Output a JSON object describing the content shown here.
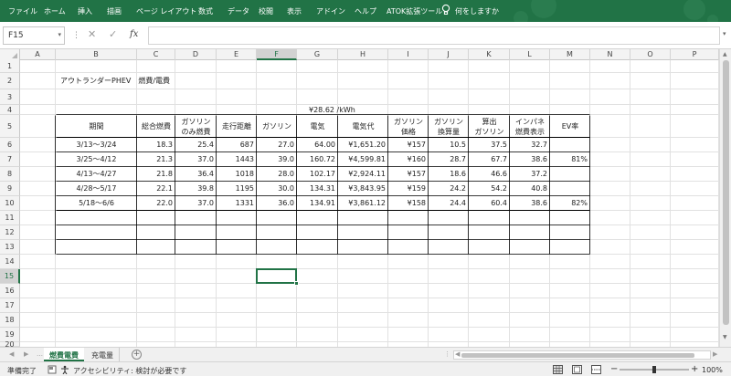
{
  "ribbon": {
    "tabs": [
      "ファイル",
      "ホーム",
      "挿入",
      "描画",
      "ページ レイアウト",
      "数式",
      "データ",
      "校閲",
      "表示",
      "アドイン",
      "ヘルプ",
      "ATOK拡張ツール"
    ],
    "tell_me": "何をしますか"
  },
  "formula_bar": {
    "name_box": "F15",
    "value": ""
  },
  "columns": [
    "A",
    "B",
    "C",
    "D",
    "E",
    "F",
    "G",
    "H",
    "I",
    "J",
    "K",
    "L",
    "M",
    "N",
    "O",
    "P"
  ],
  "rows": [
    "1",
    "2",
    "3",
    "4",
    "5",
    "6",
    "7",
    "8",
    "9",
    "10",
    "11",
    "12",
    "13",
    "14",
    "15",
    "16",
    "17",
    "18",
    "19",
    "20"
  ],
  "selected_cell": {
    "col": "F",
    "row": "15"
  },
  "sheet": {
    "title": "アウトランダーPHEV　燃費/電費",
    "rate": "¥28.62 /kWh",
    "headers": [
      [
        "期間"
      ],
      [
        "総合燃費"
      ],
      [
        "ガソリン",
        "のみ燃費"
      ],
      [
        "走行距離"
      ],
      [
        "ガソリン"
      ],
      [
        "電気"
      ],
      [
        "電気代"
      ],
      [
        "ガソリン",
        "価格"
      ],
      [
        "ガソリン",
        "換算量"
      ],
      [
        "算出",
        "ガソリン"
      ],
      [
        "インパネ",
        "燃費表示"
      ],
      [
        "EV率"
      ]
    ],
    "rows": [
      [
        "3/13～3/24",
        "18.3",
        "25.4",
        "687",
        "27.0",
        "64.00",
        "¥1,651.20",
        "¥157",
        "10.5",
        "37.5",
        "32.7",
        ""
      ],
      [
        "3/25～4/12",
        "21.3",
        "37.0",
        "1443",
        "39.0",
        "160.72",
        "¥4,599.81",
        "¥160",
        "28.7",
        "67.7",
        "38.6",
        "81%"
      ],
      [
        "4/13～4/27",
        "21.8",
        "36.4",
        "1018",
        "28.0",
        "102.17",
        "¥2,924.11",
        "¥157",
        "18.6",
        "46.6",
        "37.2",
        ""
      ],
      [
        "4/28～5/17",
        "22.1",
        "39.8",
        "1195",
        "30.0",
        "134.31",
        "¥3,843.95",
        "¥159",
        "24.2",
        "54.2",
        "40.8",
        ""
      ],
      [
        "5/18～6/6",
        "22.0",
        "37.0",
        "1331",
        "36.0",
        "134.91",
        "¥3,861.12",
        "¥158",
        "24.4",
        "60.4",
        "38.6",
        "82%"
      ]
    ]
  },
  "sheet_tabs": [
    {
      "label": "燃費電費",
      "active": true
    },
    {
      "label": "充電量",
      "active": false
    }
  ],
  "status_bar": {
    "ready": "準備完了",
    "accessibility": "アクセシビリティ: 検討が必要です",
    "zoom": "100%"
  },
  "colors": {
    "accent": "#217346"
  }
}
